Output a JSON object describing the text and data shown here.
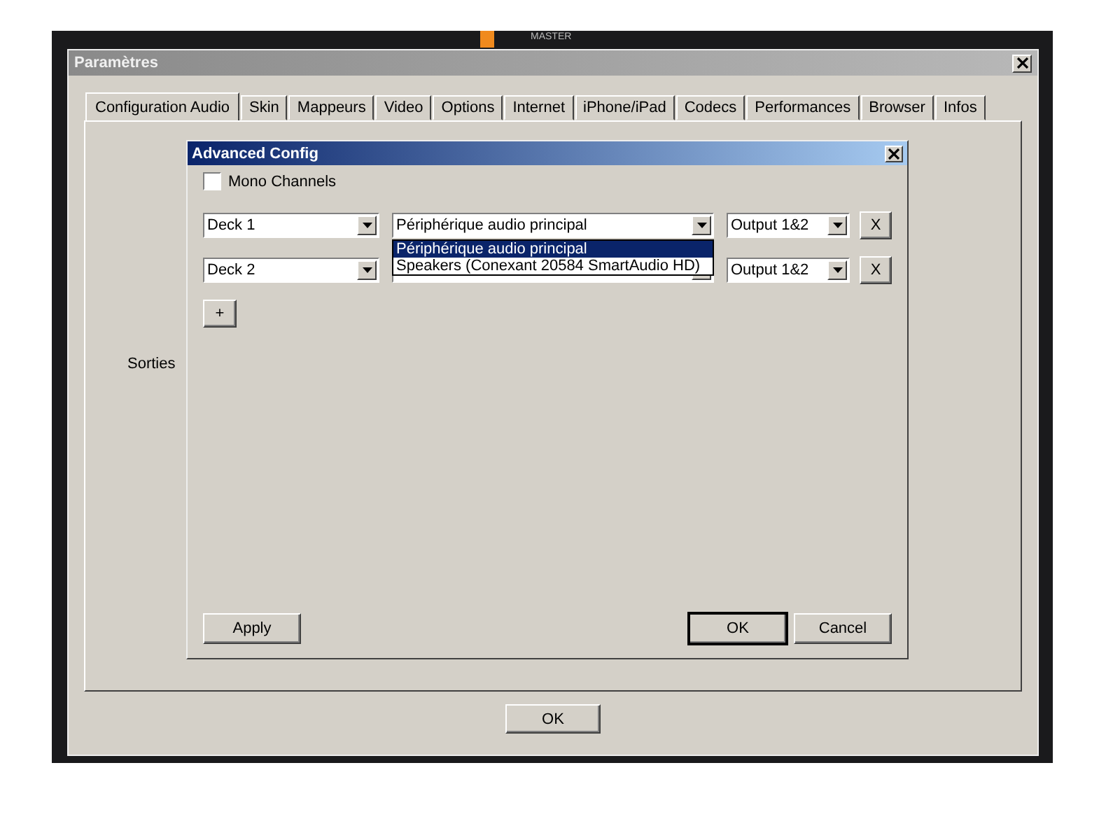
{
  "background_app": {
    "label": "MASTER"
  },
  "window": {
    "title": "Paramètres"
  },
  "tabs": [
    {
      "label": "Configuration Audio",
      "selected": true
    },
    {
      "label": "Skin",
      "selected": false
    },
    {
      "label": "Mappeurs",
      "selected": false
    },
    {
      "label": "Video",
      "selected": false
    },
    {
      "label": "Options",
      "selected": false
    },
    {
      "label": "Internet",
      "selected": false
    },
    {
      "label": "iPhone/iPad",
      "selected": false
    },
    {
      "label": "Codecs",
      "selected": false
    },
    {
      "label": "Performances",
      "selected": false
    },
    {
      "label": "Browser",
      "selected": false
    },
    {
      "label": "Infos",
      "selected": false
    }
  ],
  "tab_panel": {
    "label": "Sorties"
  },
  "dialog": {
    "title": "Advanced Config",
    "mono_channels": {
      "label": "Mono Channels",
      "checked": false
    },
    "rows": [
      {
        "deck": "Deck 1",
        "device": "Périphérique audio principal",
        "output": "Output 1&2",
        "remove": "X",
        "expanded": true,
        "options": [
          {
            "label": "Périphérique audio principal",
            "selected": true
          },
          {
            "label": "Speakers (Conexant 20584 SmartAudio HD)",
            "selected": false
          }
        ]
      },
      {
        "deck": "Deck 2",
        "output": "Output 1&2",
        "remove": "X"
      }
    ],
    "add_button": "+",
    "buttons": [
      {
        "label": "Apply",
        "kind": "left",
        "default": false
      },
      {
        "label": "OK",
        "kind": "right",
        "default": true
      },
      {
        "label": "Cancel",
        "kind": "right",
        "default": false
      }
    ]
  },
  "buttons": [
    "OK"
  ]
}
